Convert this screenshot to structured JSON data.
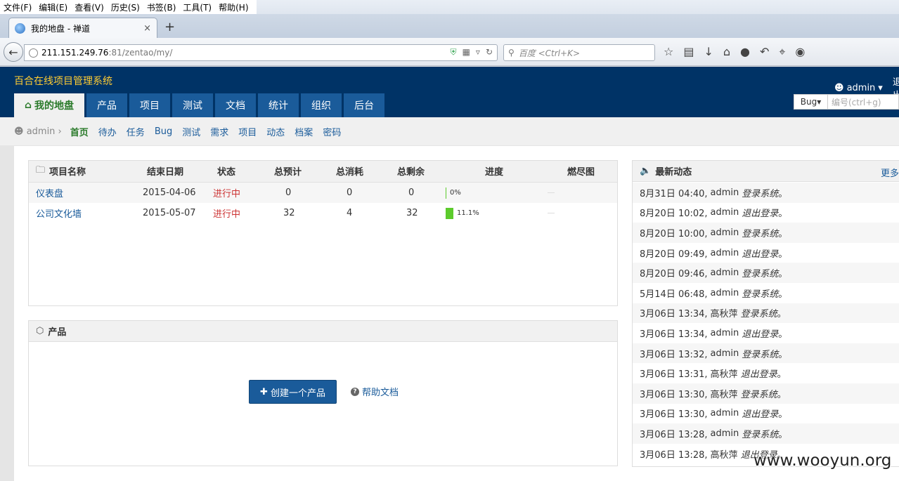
{
  "browser": {
    "menu": [
      "文件(F)",
      "编辑(E)",
      "查看(V)",
      "历史(S)",
      "书签(B)",
      "工具(T)",
      "帮助(H)"
    ],
    "tab_title": "我的地盘 - 禅道",
    "tab_close": "×",
    "new_tab": "+",
    "url_host": "211.151.249.76",
    "url_path": ":81/zentao/my/",
    "search_placeholder": "百度 <Ctrl+K>",
    "icons": [
      "star-icon",
      "reader-icon",
      "download-icon",
      "home-icon",
      "chat-icon",
      "undo-icon",
      "crop-icon",
      "comment-icon"
    ]
  },
  "app": {
    "title": "百合在线项目管理系统",
    "user": "admin",
    "logout": "退出",
    "nav": [
      "我的地盘",
      "产品",
      "项目",
      "测试",
      "文档",
      "统计",
      "组织",
      "后台"
    ],
    "quicksearch": {
      "type": "Bug",
      "placeholder": "编号(ctrl+g)"
    },
    "crumb": "admin",
    "subnav": [
      "首页",
      "待办",
      "任务",
      "Bug",
      "测试",
      "需求",
      "项目",
      "动态",
      "档案",
      "密码"
    ]
  },
  "projects": {
    "headers": [
      "项目名称",
      "结束日期",
      "状态",
      "总预计",
      "总消耗",
      "总剩余",
      "进度",
      "燃尽图"
    ],
    "rows": [
      {
        "name": "仪表盘",
        "end": "2015-04-06",
        "status": "进行中",
        "estimate": "0",
        "consumed": "0",
        "left": "0",
        "progress_label": "0%",
        "progress": 0
      },
      {
        "name": "公司文化墙",
        "end": "2015-05-07",
        "status": "进行中",
        "estimate": "32",
        "consumed": "4",
        "left": "32",
        "progress_label": "11.1%",
        "progress": 11.1
      }
    ]
  },
  "products": {
    "title": "产品",
    "create_button": "创建一个产品",
    "help_link": "帮助文档"
  },
  "dynamics": {
    "title": "最新动态",
    "more": "更多",
    "items": [
      {
        "time": "8月31日 04:40,",
        "user": "admin",
        "action": "登录系统",
        "end": "。"
      },
      {
        "time": "8月20日 10:02,",
        "user": "admin",
        "action": "退出登录",
        "end": "。"
      },
      {
        "time": "8月20日 10:00,",
        "user": "admin",
        "action": "登录系统",
        "end": "。"
      },
      {
        "time": "8月20日 09:49,",
        "user": "admin",
        "action": "退出登录",
        "end": "。"
      },
      {
        "time": "8月20日 09:46,",
        "user": "admin",
        "action": "登录系统",
        "end": "。"
      },
      {
        "time": "5月14日 06:48,",
        "user": "admin",
        "action": "登录系统",
        "end": "。"
      },
      {
        "time": "3月06日 13:34,",
        "user": "高秋萍",
        "action": "登录系统",
        "end": "。"
      },
      {
        "time": "3月06日 13:34,",
        "user": "admin",
        "action": "退出登录",
        "end": "。"
      },
      {
        "time": "3月06日 13:32,",
        "user": "admin",
        "action": "登录系统",
        "end": "。"
      },
      {
        "time": "3月06日 13:31,",
        "user": "高秋萍",
        "action": "退出登录",
        "end": "。"
      },
      {
        "time": "3月06日 13:30,",
        "user": "高秋萍",
        "action": "登录系统",
        "end": "。"
      },
      {
        "time": "3月06日 13:30,",
        "user": "admin",
        "action": "退出登录",
        "end": "。"
      },
      {
        "time": "3月06日 13:28,",
        "user": "admin",
        "action": "登录系统",
        "end": "。"
      },
      {
        "time": "3月06日 13:28,",
        "user": "高秋萍",
        "action": "退出登录",
        "end": "。"
      }
    ]
  },
  "watermark": "www.wooyun.org",
  "colors": {
    "header": "#003366",
    "nav": "#1a5b9a",
    "title": "#ffcc33",
    "progress": "#5ccb2c",
    "status": "#cc3333"
  }
}
